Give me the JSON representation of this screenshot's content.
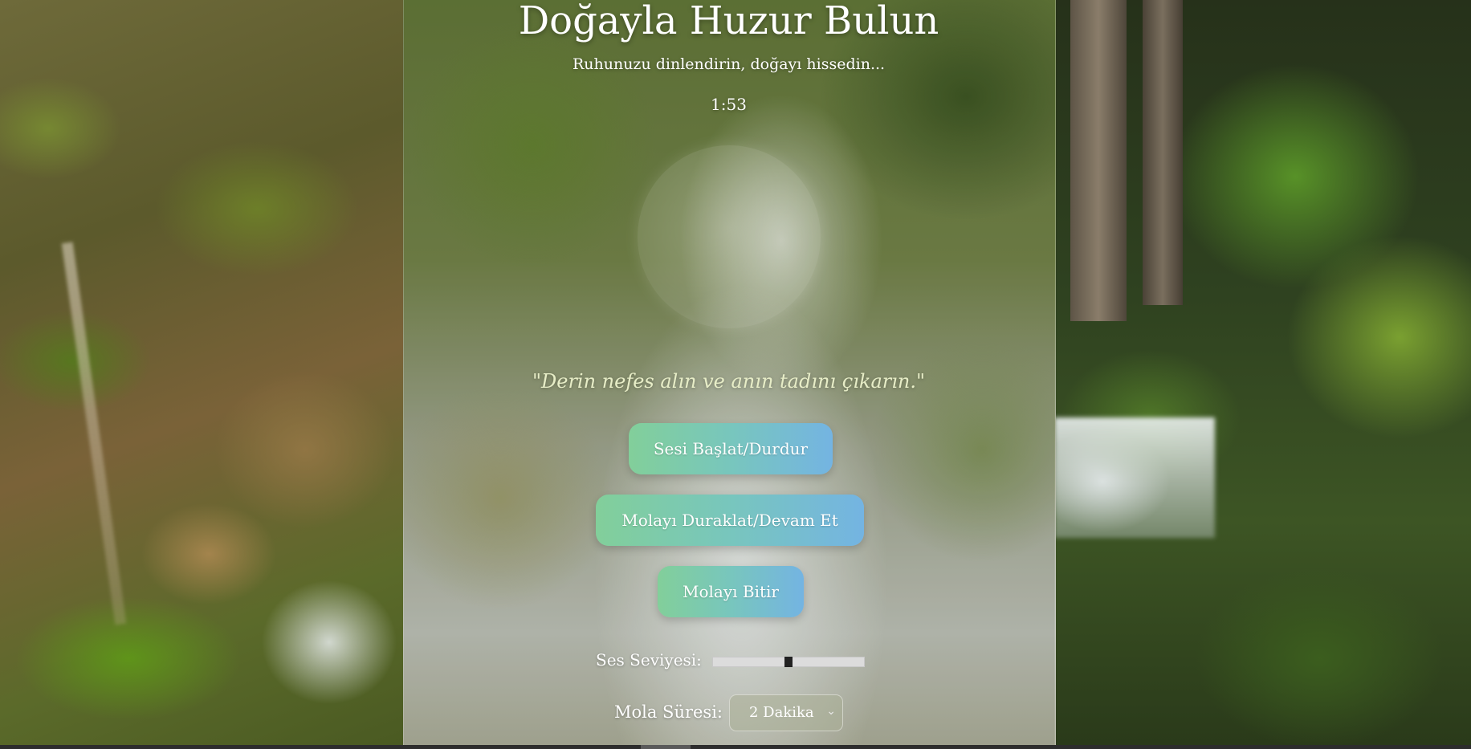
{
  "header": {
    "title": "Doğayla Huzur Bulun",
    "subtitle": "Ruhunuzu dinlendirin, doğayı hissedin...",
    "timer": "1:53"
  },
  "quote": "\"Derin nefes alın ve anın tadını çıkarın.\"",
  "controls": {
    "sound_button": "Sesi Başlat/Durdur",
    "pause_button": "Molayı Duraklat/Devam Et",
    "end_button": "Molayı Bitir"
  },
  "volume": {
    "label": "Ses Seviyesi:",
    "level_percent": 50
  },
  "duration": {
    "label": "Mola Süresi:",
    "selected": "2 Dakika"
  },
  "icons": {
    "select_chevron": "chevron-down-icon"
  },
  "colors": {
    "button_gradient_start": "#82cf9a",
    "button_gradient_end": "#74b4e2",
    "quote_color": "#e7edc7",
    "slider_track": "#dcdcdc",
    "slider_thumb": "#222222"
  }
}
